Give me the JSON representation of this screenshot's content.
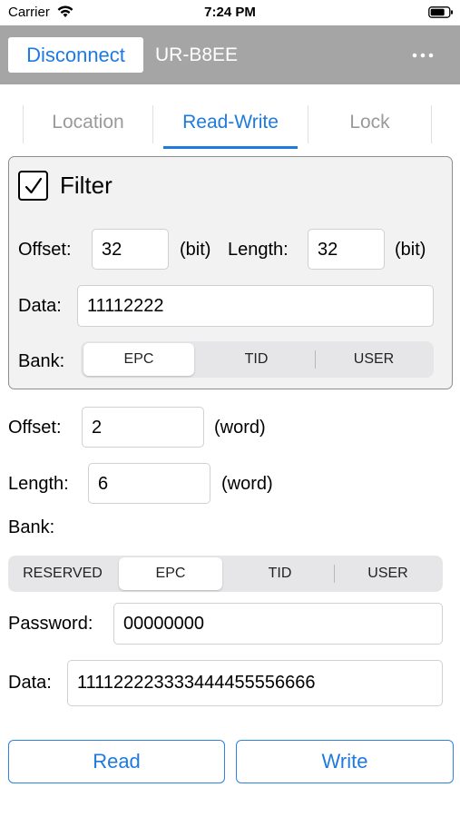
{
  "status_bar": {
    "carrier": "Carrier",
    "time": "7:24 PM"
  },
  "nav": {
    "disconnect_label": "Disconnect",
    "device_name": "UR-B8EE"
  },
  "tabs": [
    {
      "label": "Location",
      "active": false
    },
    {
      "label": "Read-Write",
      "active": true
    },
    {
      "label": "Lock",
      "active": false
    }
  ],
  "filter": {
    "checked": true,
    "label": "Filter",
    "offset_label": "Offset:",
    "offset_value": "32",
    "offset_unit": "(bit)",
    "length_label": "Length:",
    "length_value": "32",
    "length_unit": "(bit)",
    "data_label": "Data:",
    "data_value": "11112222",
    "bank_label": "Bank:",
    "bank_options": [
      "EPC",
      "TID",
      "USER"
    ],
    "bank_selected": "EPC"
  },
  "rw": {
    "offset_label": "Offset:",
    "offset_value": "2",
    "offset_unit": "(word)",
    "length_label": "Length:",
    "length_value": "6",
    "length_unit": "(word)",
    "bank_label": "Bank:",
    "bank_options": [
      "RESERVED",
      "EPC",
      "TID",
      "USER"
    ],
    "bank_selected": "EPC",
    "password_label": "Password:",
    "password_value": "00000000",
    "data_label": "Data:",
    "data_value": "111122223333444455556666"
  },
  "actions": {
    "read_label": "Read",
    "write_label": "Write"
  },
  "colors": {
    "accent": "#1f7ae0",
    "nav_bg": "#a5a5a5",
    "filter_bg": "#f2f2f2"
  }
}
